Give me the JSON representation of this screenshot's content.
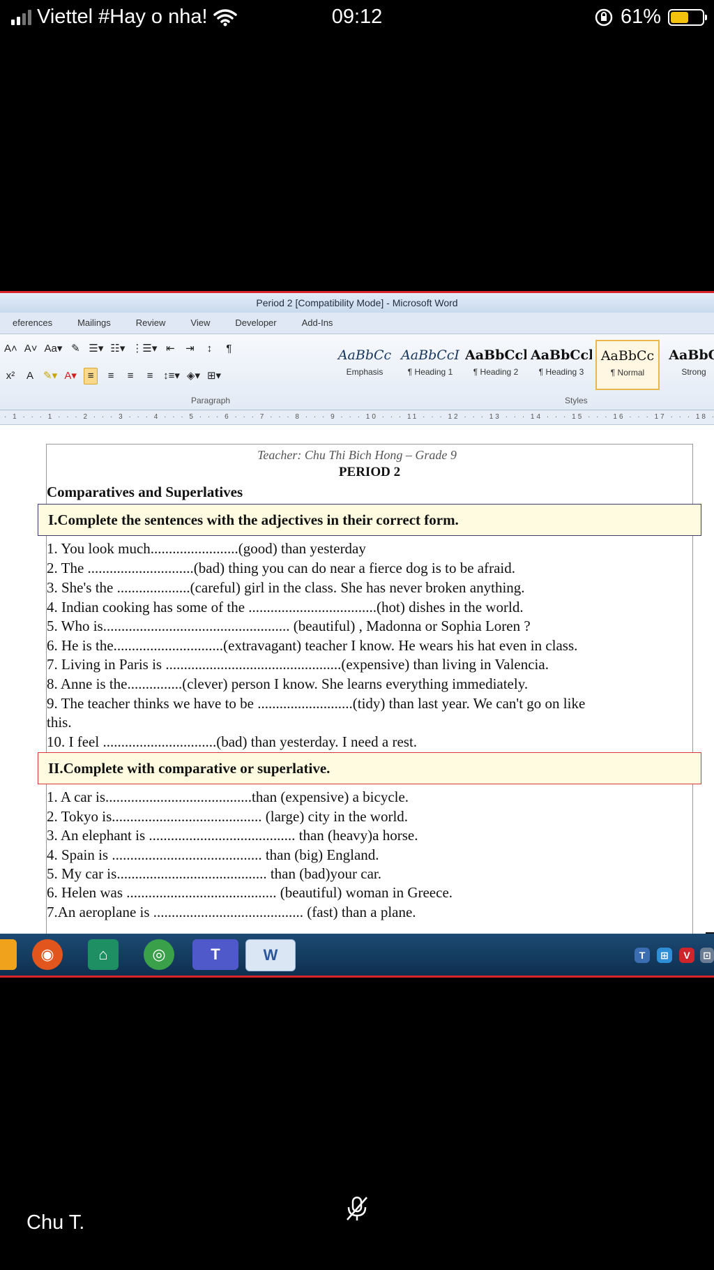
{
  "status_bar": {
    "carrier": "Viettel #Hay o nha!",
    "time": "09:12",
    "battery": "61%",
    "battery_level": 0.61
  },
  "word": {
    "window_title": "Period 2 [Compatibility Mode] - Microsoft Word",
    "tabs": [
      "eferences",
      "Mailings",
      "Review",
      "View",
      "Developer",
      "Add-Ins"
    ],
    "group_labels": {
      "paragraph": "Paragraph",
      "styles": "Styles"
    },
    "styles": [
      {
        "sample": "AaBbCc",
        "name": "Emphasis"
      },
      {
        "sample": "AaBbCcI",
        "name": "¶ Heading 1"
      },
      {
        "sample": "AaBbCcl",
        "name": "¶ Heading 2"
      },
      {
        "sample": "AaBbCcl",
        "name": "¶ Heading 3"
      },
      {
        "sample": "AaBbCc",
        "name": "¶ Normal"
      },
      {
        "sample": "AaBbC",
        "name": "Strong"
      }
    ]
  },
  "document": {
    "teacher": "Teacher: Chu Thi Bich Hong – Grade 9",
    "period": "PERIOD 2",
    "topic": "Comparatives and Superlatives",
    "section1_title": "I.Complete the sentences with the adjectives in their correct form.",
    "section1_lines": [
      "1. You look much........................(good) than yesterday",
      "2. The .............................(bad) thing you can do near a fierce dog is to be afraid.",
      "3. She's the ....................(careful) girl in the class. She has never broken anything.",
      "4. Indian cooking has some of the ...................................(hot) dishes in the world.",
      "5. Who is................................................... (beautiful) , Madonna or Sophia Loren ?",
      "6. He is the..............................(extravagant) teacher I know. He wears his hat even in class.",
      "7. Living in Paris is ................................................(expensive) than living in Valencia.",
      "8. Anne is the...............(clever) person I know. She learns everything immediately.",
      "9. The teacher thinks we have to be ..........................(tidy) than last year. We can't go on like",
      "this.",
      "10. I feel ...............................(bad) than yesterday. I need a rest."
    ],
    "section2_title": "II.Complete with comparative or superlative.",
    "section2_lines": [
      "1. A car is........................................than (expensive) a bicycle.",
      "2. Tokyo is......................................... (large) city in the world.",
      "3. An elephant is ........................................ than (heavy)a horse.",
      "4. Spain is ......................................... than (big) England.",
      "5. My car is......................................... than (bad)your car.",
      "6. Helen was ......................................... (beautiful) woman in Greece.",
      "7.An aeroplane is ......................................... (fast) than a plane."
    ]
  },
  "participant": {
    "name": "Chu T."
  }
}
